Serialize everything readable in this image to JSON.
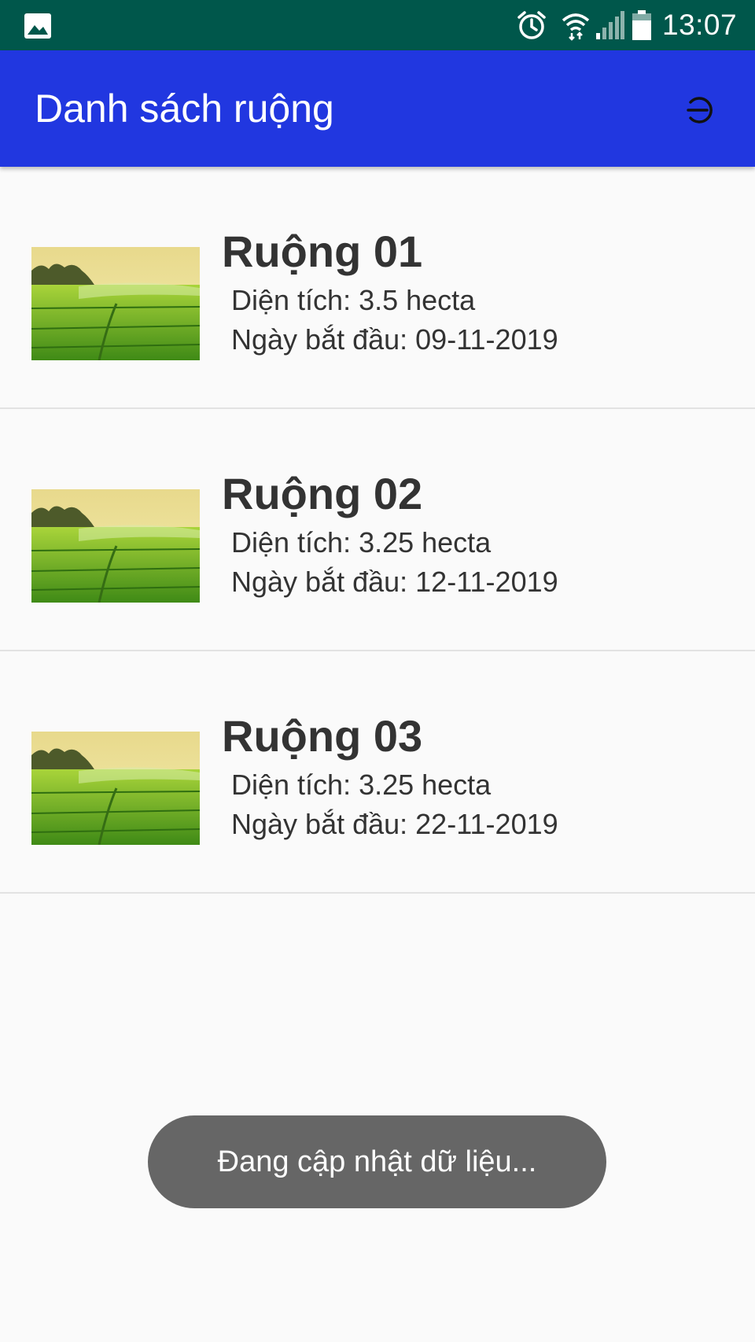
{
  "status_bar": {
    "time": "13:07",
    "icons": [
      "gallery-icon",
      "alarm-icon",
      "wifi-icon",
      "signal-icon",
      "battery-icon"
    ],
    "background_color": "#00574b"
  },
  "app_bar": {
    "title": "Danh sách ruộng",
    "action_icon": "logout-icon",
    "background_color": "#2137e0"
  },
  "fields": [
    {
      "name": "Ruộng 01",
      "area_label": "Diện tích: 3.5 hecta",
      "start_label": "Ngày bắt đầu: 09-11-2019",
      "image_icon": "rice-field-photo"
    },
    {
      "name": "Ruộng 02",
      "area_label": "Diện tích: 3.25 hecta",
      "start_label": "Ngày bắt đầu: 12-11-2019",
      "image_icon": "rice-field-photo"
    },
    {
      "name": "Ruộng 03",
      "area_label": "Diện tích: 3.25 hecta",
      "start_label": "Ngày bắt đầu: 22-11-2019",
      "image_icon": "rice-field-photo"
    }
  ],
  "toast": {
    "message": "Đang cập nhật dữ liệu..."
  }
}
